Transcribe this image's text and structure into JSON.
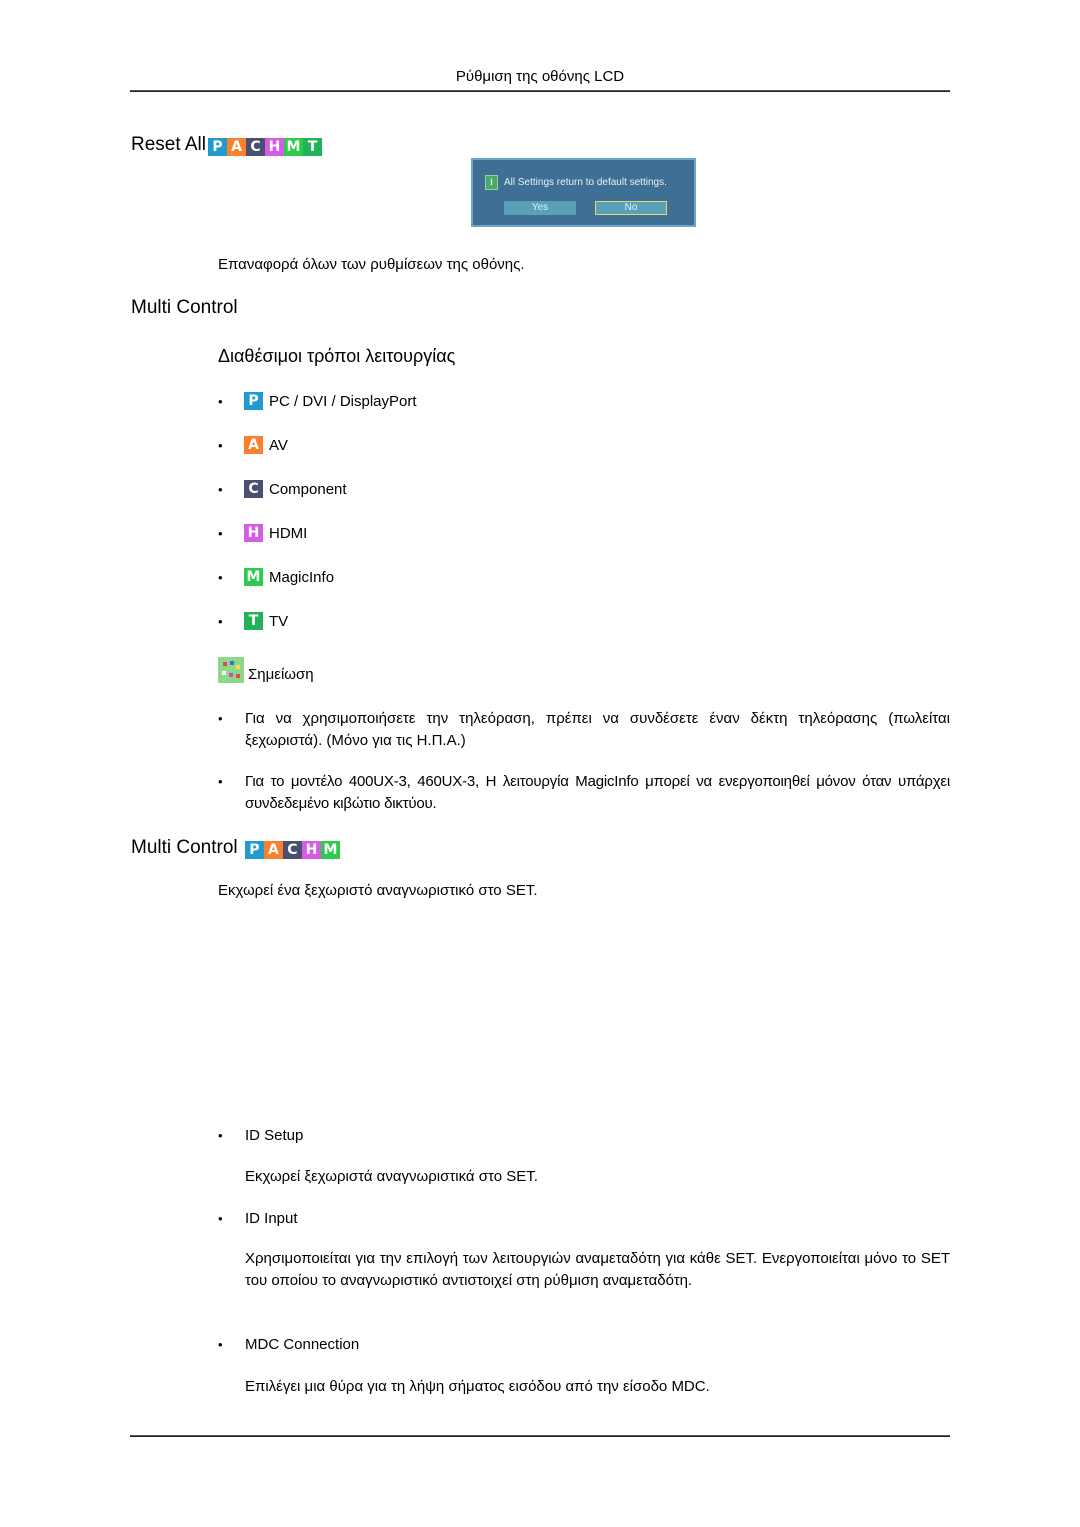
{
  "header": {
    "title": "Ρύθμιση της οθόνης LCD"
  },
  "badge_colors": {
    "P": "#1f9ccd",
    "A": "#f7812f",
    "C": "#4a5070",
    "H": "#d65ce8",
    "M": "#2ecb4a",
    "T": "#22b35a"
  },
  "reset_all": {
    "title": "Reset All",
    "badges": [
      "P",
      "A",
      "C",
      "H",
      "M",
      "T"
    ],
    "dialog": {
      "icon": "info-icon",
      "message": "All Settings return to default settings.",
      "yes_label": "Yes",
      "no_label": "No",
      "selected": "No"
    },
    "description": "Επαναφορά όλων των ρυθμίσεων της οθόνης."
  },
  "multi_control_modes": {
    "title": "Multi Control",
    "subtitle": "Διαθέσιμοι τρόποι λειτουργίας",
    "modes": [
      {
        "badge": "P",
        "label": "PC / DVI / DisplayPort"
      },
      {
        "badge": "A",
        "label": "AV"
      },
      {
        "badge": "C",
        "label": "Component"
      },
      {
        "badge": "H",
        "label": "HDMI"
      },
      {
        "badge": "M",
        "label": "MagicInfo"
      },
      {
        "badge": "T",
        "label": "TV"
      }
    ],
    "note": {
      "icon": "note-icon",
      "label": "Σημείωση",
      "items": [
        "Για να χρησιμοποιήσετε την τηλεόραση, πρέπει να συνδέσετε έναν δέκτη τηλεόρασης (πωλείται ξεχωριστά). (Μόνο για τις Η.Π.Α.)",
        {
          "before": "Για το μοντέλο 400UX-3, 460UX-3, Η λειτουργία ",
          "bold": "MagicInfo",
          "after": " μπορεί να ενεργοποιηθεί μόνον όταν υπάρχει συνδεδεμένο κιβώτιο δικτύου."
        }
      ]
    }
  },
  "multi_control": {
    "title": "Multi Control",
    "badges": [
      "P",
      "A",
      "C",
      "H",
      "M"
    ],
    "description": "Εκχωρεί ένα ξεχωριστό αναγνωριστικό στο SET.",
    "items": [
      {
        "label": "ID Setup",
        "description": "Εκχωρεί ξεχωριστά αναγνωριστικά στο SET."
      },
      {
        "label": "ID Input",
        "description": "Χρησιμοποιείται για την επιλογή των λειτουργιών αναμεταδότη για κάθε SET. Ενεργοποιείται μόνο το SET του οποίου το αναγνωριστικό αντιστοιχεί στη ρύθμιση αναμεταδότη."
      },
      {
        "label": "MDC Connection",
        "description": "Επιλέγει μια θύρα για τη λήψη σήματος εισόδου από την είσοδο MDC."
      }
    ]
  },
  "bullet_char": "•"
}
